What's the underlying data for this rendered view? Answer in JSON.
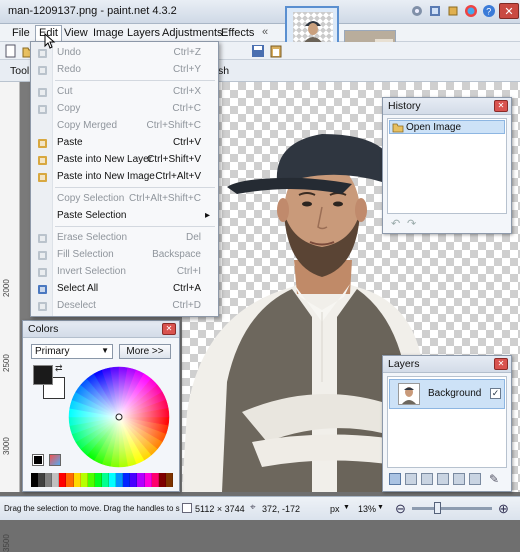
{
  "window": {
    "title": "man-1209137.png - paint.net 4.3.2",
    "minimize": "–",
    "maximize": "□",
    "close": "✕"
  },
  "menubar": [
    "File",
    "Edit",
    "View",
    "Image",
    "Layers",
    "Adjustments",
    "Effects"
  ],
  "toolbar_partial": {
    "tools_label": "Tool",
    "partial_text": "sh"
  },
  "edit_menu": {
    "items": [
      {
        "label": "Undo",
        "shortcut": "Ctrl+Z",
        "enabled": false,
        "icon": "undo-icon"
      },
      {
        "label": "Redo",
        "shortcut": "Ctrl+Y",
        "enabled": false,
        "icon": "redo-icon"
      },
      {
        "label": "Cut",
        "shortcut": "Ctrl+X",
        "enabled": false,
        "icon": "scissors-icon"
      },
      {
        "label": "Copy",
        "shortcut": "Ctrl+C",
        "enabled": false,
        "icon": "copy-icon"
      },
      {
        "label": "Copy Merged",
        "shortcut": "Ctrl+Shift+C",
        "enabled": false,
        "icon": ""
      },
      {
        "label": "Paste",
        "shortcut": "Ctrl+V",
        "enabled": true,
        "icon": "paste-icon"
      },
      {
        "label": "Paste into New Layer",
        "shortcut": "Ctrl+Shift+V",
        "enabled": true,
        "icon": "paste-layer-icon"
      },
      {
        "label": "Paste into New Image",
        "shortcut": "Ctrl+Alt+V",
        "enabled": true,
        "icon": "paste-image-icon"
      },
      {
        "label": "Copy Selection",
        "shortcut": "Ctrl+Alt+Shift+C",
        "enabled": false,
        "icon": ""
      },
      {
        "label": "Paste Selection",
        "shortcut": "▸",
        "enabled": true,
        "icon": ""
      },
      {
        "label": "Erase Selection",
        "shortcut": "Del",
        "enabled": false,
        "icon": "erase-icon"
      },
      {
        "label": "Fill Selection",
        "shortcut": "Backspace",
        "enabled": false,
        "icon": "fill-icon"
      },
      {
        "label": "Invert Selection",
        "shortcut": "Ctrl+I",
        "enabled": false,
        "icon": "invert-icon"
      },
      {
        "label": "Select All",
        "shortcut": "Ctrl+A",
        "enabled": true,
        "icon": "select-all-icon"
      },
      {
        "label": "Deselect",
        "shortcut": "Ctrl+D",
        "enabled": false,
        "icon": "deselect-icon"
      }
    ]
  },
  "history": {
    "title": "History",
    "items": [
      "Open Image"
    ]
  },
  "layers": {
    "title": "Layers",
    "items": [
      {
        "name": "Background",
        "visible": true
      }
    ]
  },
  "colors": {
    "title": "Colors",
    "mode": "Primary",
    "more_button": "More >>",
    "primary_color": "#1a1a1a",
    "secondary_color": "#ffffff"
  },
  "ruler": {
    "ticks": [
      "2000",
      "2500",
      "3000",
      "3500"
    ]
  },
  "status": {
    "hint": "Drag the selection to move. Drag the handles to scale. Drag wit",
    "image_size": "5112 × 3744",
    "cursor": "372, -172",
    "unit": "px",
    "zoom": "13%"
  },
  "palette": [
    "#000000",
    "#404040",
    "#808080",
    "#c0c0c0",
    "#ff0000",
    "#ff6a00",
    "#ffd800",
    "#b6ff00",
    "#4cff00",
    "#00ff21",
    "#00ff90",
    "#00ffff",
    "#0094ff",
    "#0026ff",
    "#4800ff",
    "#b200ff",
    "#ff00dc",
    "#ff006e",
    "#7f0000",
    "#7f3300"
  ]
}
